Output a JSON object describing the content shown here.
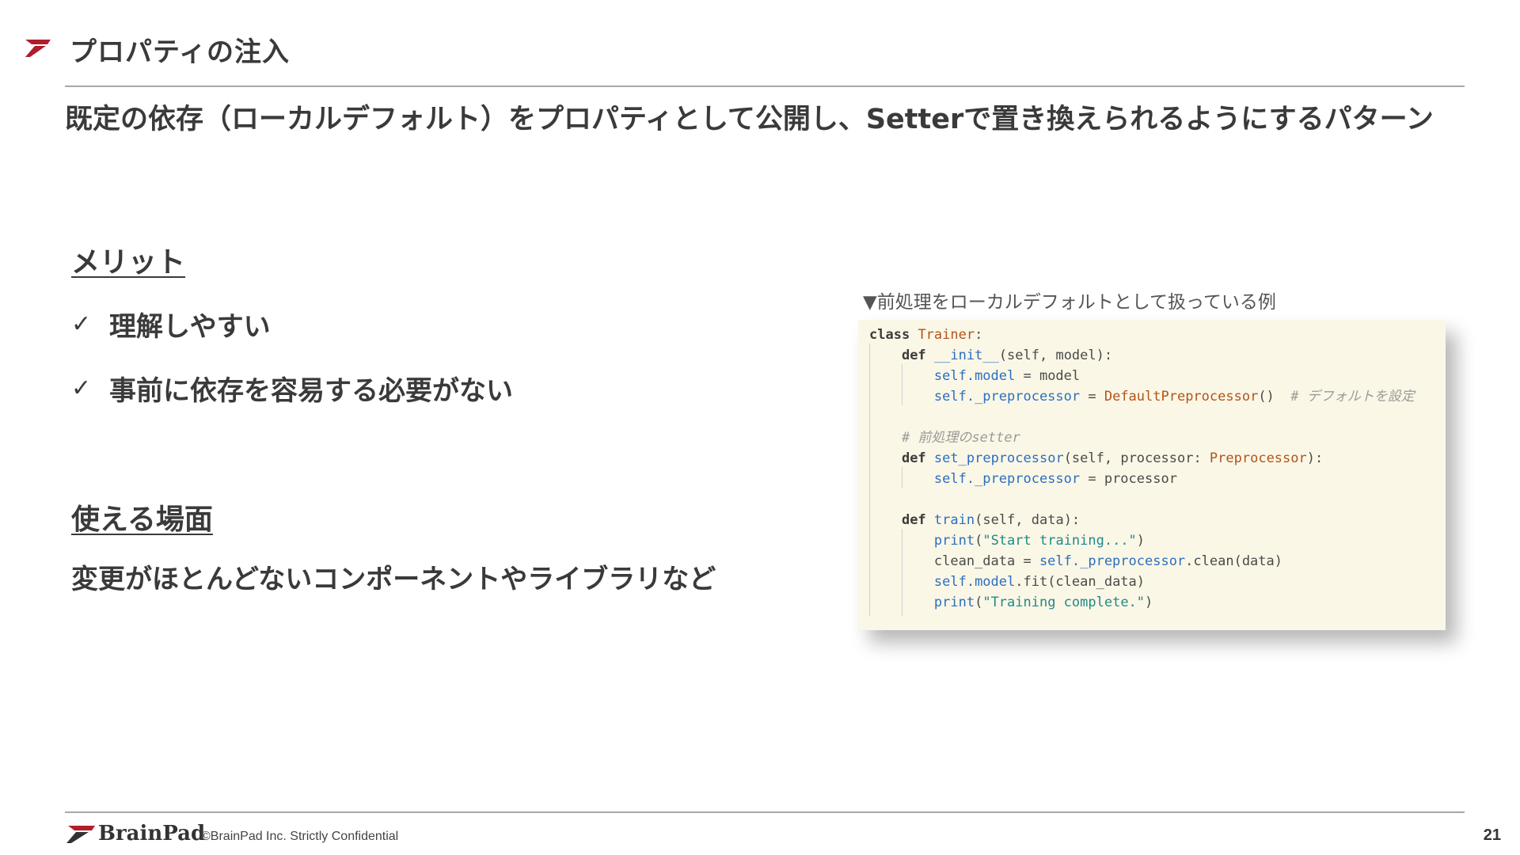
{
  "header": {
    "title": "プロパティの注入",
    "mark_icon": "brainpad-chevron-icon",
    "accent_color": "#b01e2b"
  },
  "lead": "既定の依存（ローカルデフォルト）をプロパティとして公開し、Setterで置き換えられるようにするパターン",
  "merits": {
    "heading": "メリット",
    "check_icon": "checkmark-icon",
    "items": [
      "理解しやすい",
      "事前に依存を容易する必要がない"
    ]
  },
  "use_cases": {
    "heading": "使える場面",
    "text": "変更がほとんどないコンポーネントやライブラリなど"
  },
  "code_example": {
    "caption": "▼前処理をローカルデフォルトとして扱っている例",
    "background_color": "#fbf7e6",
    "lines": [
      "class Trainer:",
      "    def __init__(self, model):",
      "        self.model = model",
      "        self._preprocessor = DefaultPreprocessor()  # デフォルトを設定",
      "",
      "    # 前処理のsetter",
      "    def set_preprocessor(self, processor: Preprocessor):",
      "        self._preprocessor = processor",
      "",
      "    def train(self, data):",
      "        print(\"Start training...\")",
      "        clean_data = self._preprocessor.clean(data)",
      "        self.model.fit(clean_data)",
      "        print(\"Training complete.\")"
    ]
  },
  "footer": {
    "logo_text": "BrainPad",
    "copyright": "©BrainPad Inc.  Strictly Confidential",
    "page_number": "21"
  }
}
